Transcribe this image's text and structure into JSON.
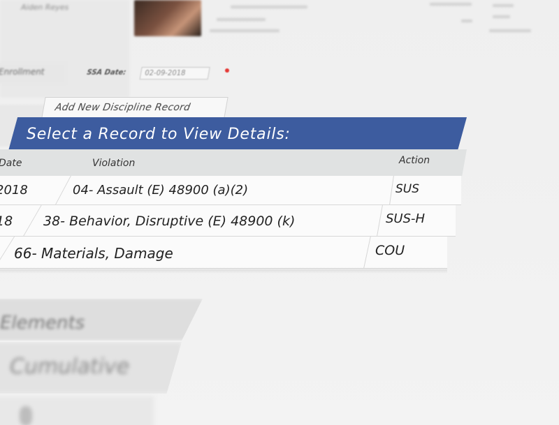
{
  "header": {
    "student_name": "Aiden Reyes"
  },
  "sidebar": {
    "enrollment_label": "Enrollment",
    "tabs": [
      {
        "label": "Elements"
      },
      {
        "label": "Cumulative"
      }
    ]
  },
  "ssa": {
    "label": "SSA Date:",
    "value": "02-09-2018"
  },
  "add_record": {
    "label": "Add New Discipline Record"
  },
  "records": {
    "title": "Select a Record to View Details:",
    "columns": {
      "date": "Date",
      "violation": "Violation",
      "action": "Action"
    },
    "rows": [
      {
        "date": "2018",
        "violation": "04- Assault (E) 48900 (a)(2)",
        "action": "SUS"
      },
      {
        "date": "18",
        "violation": "38- Behavior, Disruptive (E) 48900 (k)",
        "action": "SUS-H"
      },
      {
        "date": "",
        "violation": "66- Materials, Damage",
        "action": "COU"
      }
    ]
  },
  "colors": {
    "header_bg": "#3d5c9f",
    "header_text": "#ffffff",
    "column_header_bg": "#e0e2e2",
    "required": "#e53935"
  }
}
